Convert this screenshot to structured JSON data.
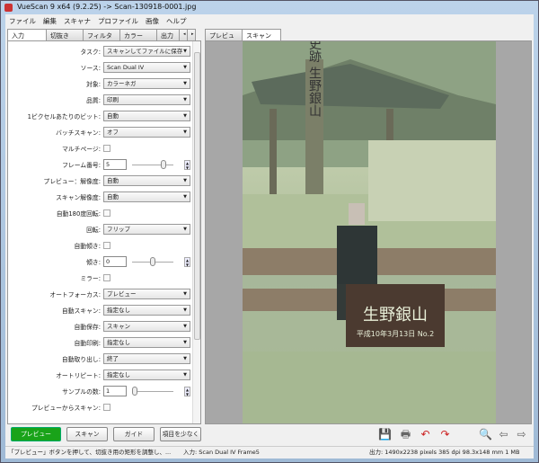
{
  "window": {
    "title": "VueScan 9 x64 (9.2.25) -> Scan-130918-0001.jpg"
  },
  "menu": [
    "ファイル",
    "編集",
    "スキャナ",
    "プロファイル",
    "画像",
    "ヘルプ"
  ],
  "left_tabs": [
    "入力",
    "切抜き",
    "フィルタ",
    "カラー",
    "出力"
  ],
  "right_tabs": [
    "プレビュー",
    "スキャン"
  ],
  "settings": [
    {
      "label": "タスク:",
      "type": "select",
      "value": "スキャンしてファイルに保存"
    },
    {
      "label": "ソース:",
      "type": "select",
      "value": "Scan Dual IV"
    },
    {
      "label": "対象:",
      "type": "select",
      "value": "カラーネガ"
    },
    {
      "label": "品質:",
      "type": "select",
      "value": "印刷"
    },
    {
      "label": "1ピクセルあたりのビット:",
      "type": "select",
      "value": "自動"
    },
    {
      "label": "バッチスキャン:",
      "type": "select",
      "value": "オフ"
    },
    {
      "label": "マルチページ:",
      "type": "checkbox",
      "value": ""
    },
    {
      "label": "フレーム番号:",
      "type": "number",
      "value": "5",
      "slider": 0.8
    },
    {
      "label": "プレビュー：解像度:",
      "type": "select",
      "value": "自動"
    },
    {
      "label": "スキャン解像度:",
      "type": "select",
      "value": "自動"
    },
    {
      "label": "自動180度回転:",
      "type": "checkbox",
      "value": ""
    },
    {
      "label": "回転:",
      "type": "select",
      "value": "フリップ"
    },
    {
      "label": "自動傾き:",
      "type": "checkbox",
      "value": ""
    },
    {
      "label": "傾き:",
      "type": "number",
      "value": "0",
      "slider": 0.5
    },
    {
      "label": "ミラー:",
      "type": "checkbox",
      "value": ""
    },
    {
      "label": "オートフォーカス:",
      "type": "select",
      "value": "プレビュー"
    },
    {
      "label": "自動スキャン:",
      "type": "select",
      "value": "指定なし"
    },
    {
      "label": "自動保存:",
      "type": "select",
      "value": "スキャン"
    },
    {
      "label": "自動印刷:",
      "type": "select",
      "value": "指定なし"
    },
    {
      "label": "自動取り出し:",
      "type": "select",
      "value": "終了"
    },
    {
      "label": "オートリピート:",
      "type": "select",
      "value": "指定なし"
    },
    {
      "label": "サンプルの数:",
      "type": "number",
      "value": "1",
      "slider": 0.0
    },
    {
      "label": "プレビューからスキャン:",
      "type": "checkbox",
      "value": ""
    }
  ],
  "buttons": {
    "preview": "プレビュー",
    "scan": "スキャン",
    "guide": "ガイド",
    "fewer": "項目を少なく"
  },
  "status": {
    "hint": "「プレビュー」ボタンを押して、切抜き用の矩形を調整し、...",
    "input": "入力: Scan Dual IV Frame5",
    "output": "出力: 1490x2238 pixels 385 dpi 98.3x148 mm 1 MB"
  },
  "photo": {
    "sign": "生野銀山",
    "pillar": "史跡 生野銀山",
    "date": "平成10年3月13日 No.2"
  }
}
